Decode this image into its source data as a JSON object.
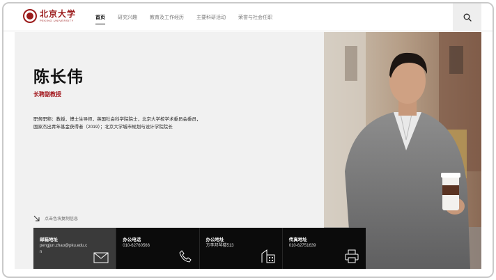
{
  "logo": {
    "cn": "北京大学",
    "en": "PEKING UNIVERSITY"
  },
  "nav": {
    "items": [
      {
        "label": "首页",
        "active": true
      },
      {
        "label": "研究兴趣",
        "active": false
      },
      {
        "label": "教育及工作经历",
        "active": false
      },
      {
        "label": "主要科研活动",
        "active": false
      },
      {
        "label": "荣誉与社会任职",
        "active": false
      }
    ]
  },
  "icons": {
    "search": "search-icon",
    "arrow": "arrow-down-right-icon",
    "mail": "mail-icon",
    "phone": "phone-icon",
    "building": "building-icon",
    "printer": "printer-icon"
  },
  "profile": {
    "name": "陈长伟",
    "title": "长聘副教授",
    "bio_line1": "职务职称：教授，博士生导师，英国社会科学院院士，北京大学校学术委员会委员，",
    "bio_line2": "国家杰出青年基金获得者（2019）；北京大学城市规划与设计学院院长"
  },
  "copy_hint": "点击色块复制信息",
  "contacts": [
    {
      "label": "邮箱地址",
      "value": "pengjun.zhao@pku.edu.cn",
      "icon": "mail-icon"
    },
    {
      "label": "办公电话",
      "value": "010-62760566",
      "icon": "phone-icon"
    },
    {
      "label": "办公地址",
      "value": "方李邦琴楼513",
      "icon": "building-icon"
    },
    {
      "label": "传真地址",
      "value": "010-62751639",
      "icon": "printer-icon"
    }
  ],
  "colors": {
    "accent_red": "#a2161c",
    "logo_red": "#9b1b1b",
    "panel_bg": "#f1f1f1",
    "card_dark": "#0b0b0b",
    "card_first": "#3a3a3a"
  }
}
